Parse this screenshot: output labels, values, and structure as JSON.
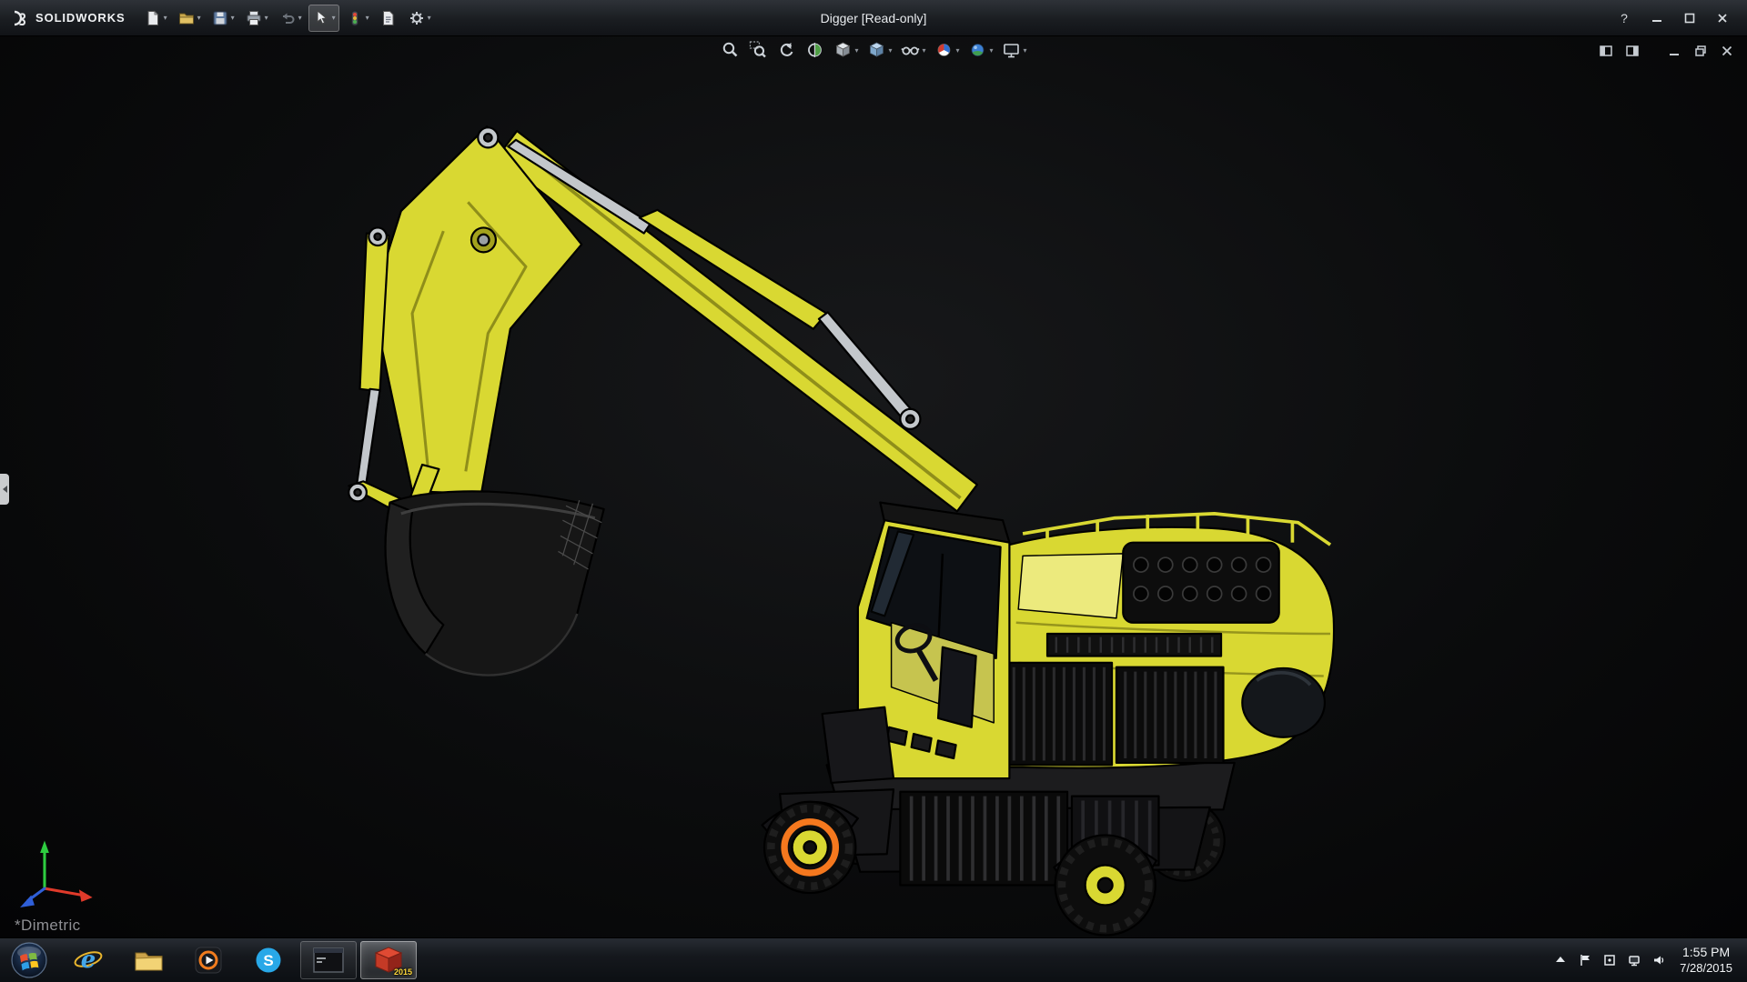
{
  "titlebar": {
    "brand": "SOLIDWORKS",
    "title": "Digger [Read-only]",
    "help_label": "?"
  },
  "quick_access_toolbar": {
    "items": [
      {
        "name": "new-document",
        "dropdown": true
      },
      {
        "name": "open-document",
        "dropdown": true
      },
      {
        "name": "save",
        "dropdown": true
      },
      {
        "name": "print",
        "dropdown": true
      },
      {
        "name": "undo",
        "dropdown": true
      },
      {
        "name": "select",
        "dropdown": true
      },
      {
        "name": "rebuild",
        "dropdown": true
      },
      {
        "name": "file-properties",
        "dropdown": false
      },
      {
        "name": "options",
        "dropdown": true
      }
    ]
  },
  "viewport": {
    "model_name": "Digger",
    "orientation_label": "*Dimetric",
    "hud_toolbar": [
      "zoom-to-fit",
      "zoom-to-area",
      "previous-view",
      "section-view",
      "view-orientation",
      "display-style",
      "hide-show-items",
      "edit-appearance",
      "apply-scene",
      "view-settings"
    ],
    "child_window_controls": [
      "pane-left",
      "pane-right",
      "minimize",
      "restore",
      "close"
    ],
    "selected_component": "front wheel (orange highlight)"
  },
  "taskbar": {
    "items": [
      "start",
      "internet-explorer",
      "file-explorer",
      "media-player",
      "skype",
      "command-prompt",
      "solidworks-2015"
    ],
    "active_item": "solidworks-2015",
    "sw_badge": "2015",
    "tray": [
      "show-hidden-icons",
      "action-center",
      "tray-app",
      "network",
      "volume"
    ],
    "clock": {
      "time": "1:55 PM",
      "date": "7/28/2015"
    }
  },
  "colors": {
    "excavator_yellow": "#d9d832",
    "excavator_yellow_dark": "#a3a21d",
    "excavator_yellow_light": "#ecea7d",
    "metal_gray": "#c3c7cb",
    "selection_orange": "#f5781e",
    "viewport_background": "#0b0c0d",
    "titlebar_background": "#1b1e22",
    "taskbar_background": "#121519",
    "triad_green": "#2ecc40",
    "triad_red": "#e03a2a",
    "triad_blue": "#2f5fd8"
  }
}
